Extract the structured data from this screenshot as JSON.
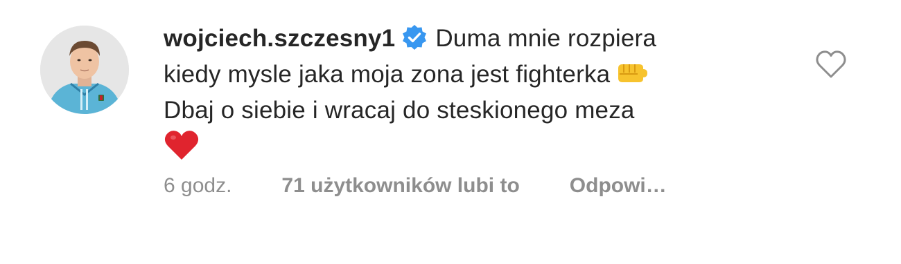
{
  "comment": {
    "username": "wojciech.szczesny1",
    "verified_icon": "verified-badge-icon",
    "lines": [
      "Duma mnie rozpiera",
      "kiedy mysle jaka moja zona jest fighterka",
      "Dbaj o siebie i wracaj do steskionego meza"
    ],
    "emoji_fist": "fist-emoji-icon",
    "emoji_heart": "red-heart-emoji-icon",
    "accent_color": "#3897f0",
    "heart_color": "#e0242e",
    "fist_color": "#f7c32e"
  },
  "meta": {
    "time": "6 godz.",
    "likes": "71 użytkowników lubi to",
    "reply": "Odpowi…"
  },
  "actions": {
    "like_icon": "heart-outline-icon"
  }
}
